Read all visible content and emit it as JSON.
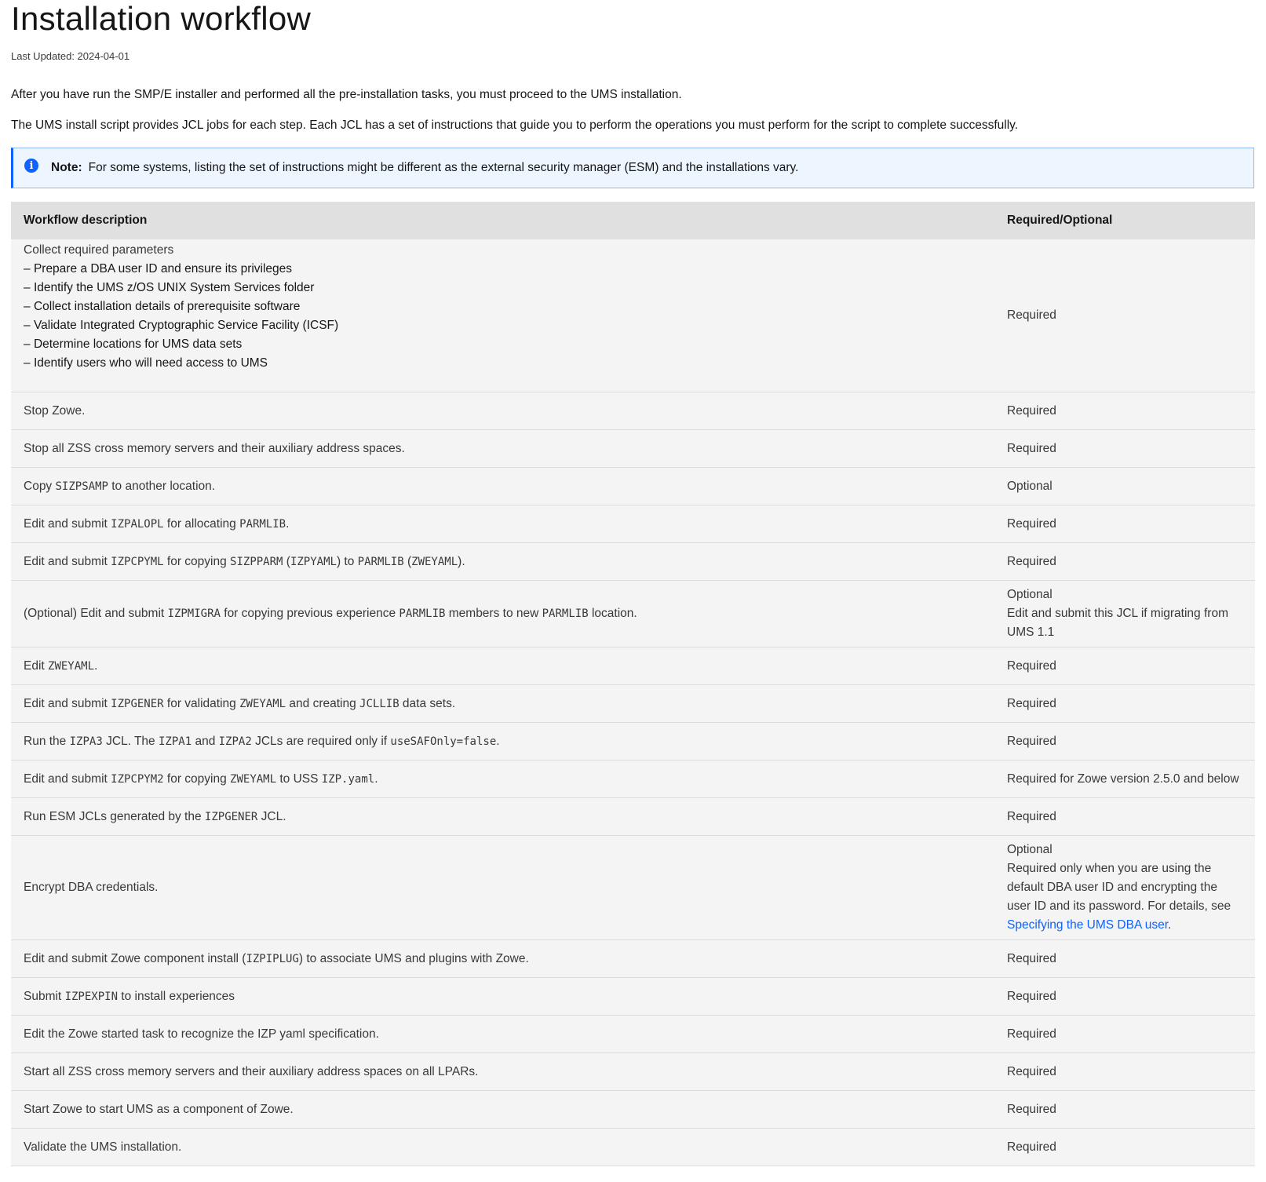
{
  "title": "Installation workflow",
  "last_updated": "Last Updated: 2024-04-01",
  "para1": "After you have run the SMP/E installer and performed all the pre-installation tasks, you must proceed to the UMS installation.",
  "para2": "The UMS install script provides JCL jobs for each step. Each JCL has a set of instructions that guide you to perform the operations you must perform for the script to complete successfully.",
  "note": {
    "icon": "info-icon",
    "label": "Note:",
    "text": "For some systems, listing the set of instructions might be different as the external security manager (ESM) and the installations vary."
  },
  "table": {
    "headers": [
      "Workflow description",
      "Required/Optional"
    ],
    "first_row": {
      "title": "Collect required parameters",
      "items": [
        "Prepare a DBA user ID and ensure its privileges",
        "Identify the UMS z/OS UNIX System Services folder",
        "Collect installation details of prerequisite software",
        "Validate Integrated Cryptographic Service Facility (ICSF)",
        "Determine locations for UMS data sets",
        "Identify users who will need access to UMS"
      ],
      "req": "Required"
    },
    "rows": [
      {
        "desc": [
          {
            "t": "Stop Zowe."
          }
        ],
        "req": "Required"
      },
      {
        "desc": [
          {
            "t": "Stop all ZSS cross memory servers and their auxiliary address spaces."
          }
        ],
        "req": "Required"
      },
      {
        "desc": [
          {
            "t": "Copy "
          },
          {
            "c": "SIZPSAMP"
          },
          {
            "t": " to another location."
          }
        ],
        "req": "Optional"
      },
      {
        "desc": [
          {
            "t": "Edit and submit "
          },
          {
            "c": "IZPALOPL"
          },
          {
            "t": " for allocating "
          },
          {
            "c": "PARMLIB"
          },
          {
            "t": "."
          }
        ],
        "req": "Required"
      },
      {
        "desc": [
          {
            "t": "Edit and submit "
          },
          {
            "c": "IZPCPYML"
          },
          {
            "t": " for copying "
          },
          {
            "c": "SIZPPARM"
          },
          {
            "t": " ("
          },
          {
            "c": "IZPYAML"
          },
          {
            "t": ") to "
          },
          {
            "c": "PARMLIB"
          },
          {
            "t": " ("
          },
          {
            "c": "ZWEYAML"
          },
          {
            "t": ")."
          }
        ],
        "req": "Required"
      },
      {
        "desc": [
          {
            "t": "(Optional) Edit and submit "
          },
          {
            "c": "IZPMIGRA"
          },
          {
            "t": " for copying previous experience "
          },
          {
            "c": "PARMLIB"
          },
          {
            "t": " members to new "
          },
          {
            "c": "PARMLIB"
          },
          {
            "t": " location."
          }
        ],
        "req": "Optional",
        "req_extra": "Edit and submit this JCL if migrating from UMS 1.1"
      },
      {
        "desc": [
          {
            "t": "Edit "
          },
          {
            "c": "ZWEYAML"
          },
          {
            "t": "."
          }
        ],
        "req": "Required"
      },
      {
        "desc": [
          {
            "t": "Edit and submit "
          },
          {
            "c": "IZPGENER"
          },
          {
            "t": " for validating "
          },
          {
            "c": "ZWEYAML"
          },
          {
            "t": " and creating "
          },
          {
            "c": "JCLLIB"
          },
          {
            "t": " data sets."
          }
        ],
        "req": "Required"
      },
      {
        "desc": [
          {
            "t": "Run the "
          },
          {
            "c": "IZPA3"
          },
          {
            "t": " JCL. The "
          },
          {
            "c": "IZPA1"
          },
          {
            "t": " and "
          },
          {
            "c": "IZPA2"
          },
          {
            "t": " JCLs are required only if "
          },
          {
            "c": "useSAFOnly=false"
          },
          {
            "t": "."
          }
        ],
        "req": "Required"
      },
      {
        "desc": [
          {
            "t": "Edit and submit "
          },
          {
            "c": "IZPCPYM2"
          },
          {
            "t": " for copying "
          },
          {
            "c": "ZWEYAML"
          },
          {
            "t": " to USS "
          },
          {
            "c": "IZP.yaml"
          },
          {
            "t": "."
          }
        ],
        "req": "Required for Zowe version 2.5.0 and below"
      },
      {
        "desc": [
          {
            "t": "Run ESM JCLs generated by the "
          },
          {
            "c": "IZPGENER"
          },
          {
            "t": " JCL."
          }
        ],
        "req": "Required"
      },
      {
        "desc": [
          {
            "t": "Encrypt DBA credentials."
          }
        ],
        "req": "Optional",
        "req_extra": "Required only when you are using the default DBA user ID and encrypting the user ID and its password. For details, see ",
        "req_link": "Specifying the UMS DBA user",
        "req_tail": "."
      },
      {
        "desc": [
          {
            "t": "Edit and submit Zowe component install ("
          },
          {
            "c": "IZPIPLUG"
          },
          {
            "t": ") to associate UMS and plugins with Zowe."
          }
        ],
        "req": "Required"
      },
      {
        "desc": [
          {
            "t": "Submit "
          },
          {
            "c": "IZPEXPIN"
          },
          {
            "t": " to install experiences"
          }
        ],
        "req": "Required"
      },
      {
        "desc": [
          {
            "t": "Edit the Zowe started task to recognize the IZP yaml specification."
          }
        ],
        "req": "Required"
      },
      {
        "desc": [
          {
            "t": "Start all ZSS cross memory servers and their auxiliary address spaces on all LPARs."
          }
        ],
        "req": "Required"
      },
      {
        "desc": [
          {
            "t": "Start Zowe to start UMS as a component of Zowe."
          }
        ],
        "req": "Required"
      },
      {
        "desc": [
          {
            "t": "Validate the UMS installation."
          }
        ],
        "req": "Required"
      }
    ]
  }
}
